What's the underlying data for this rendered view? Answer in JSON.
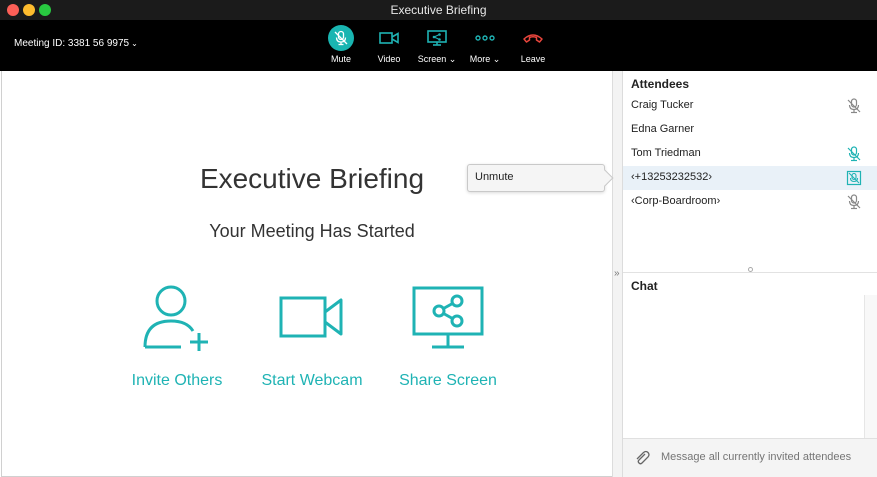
{
  "window": {
    "title": "Executive Briefing"
  },
  "toolbar": {
    "meeting_id": "Meeting ID: 3381 56 9975",
    "buttons": [
      {
        "label": "Mute",
        "icon": "mic-off-icon"
      },
      {
        "label": "Video",
        "icon": "video-camera-icon"
      },
      {
        "label": "Screen",
        "icon": "screen-share-icon"
      },
      {
        "label": "More",
        "icon": "more-dots-icon"
      },
      {
        "label": "Leave",
        "icon": "phone-hangup-icon"
      }
    ]
  },
  "main": {
    "title": "Executive Briefing",
    "subtitle": "Your Meeting Has Started",
    "actions": [
      {
        "label": "Invite Others",
        "icon": "add-user-icon"
      },
      {
        "label": "Start Webcam",
        "icon": "webcam-icon"
      },
      {
        "label": "Share Screen",
        "icon": "share-screen-icon"
      }
    ]
  },
  "sidebar": {
    "attendees_title": "Attendees",
    "attendees": [
      {
        "name": "Craig Tucker",
        "mic": "muted"
      },
      {
        "name": "Edna Garner",
        "mic": "none"
      },
      {
        "name": "Tom Triedman",
        "mic": "active"
      },
      {
        "name": "‹+13253232532›",
        "mic": "phone"
      },
      {
        "name": "‹Corp-Boardroom›",
        "mic": "muted"
      }
    ],
    "chat_title": "Chat",
    "chat_placeholder": "Message all currently invited attendees"
  },
  "tooltip": {
    "text": "Unmute"
  },
  "colors": {
    "accent": "#1fb3b4",
    "leave": "#e8453c",
    "toolbar_bg": "#000000",
    "selected_row": "#e9f1f8"
  }
}
